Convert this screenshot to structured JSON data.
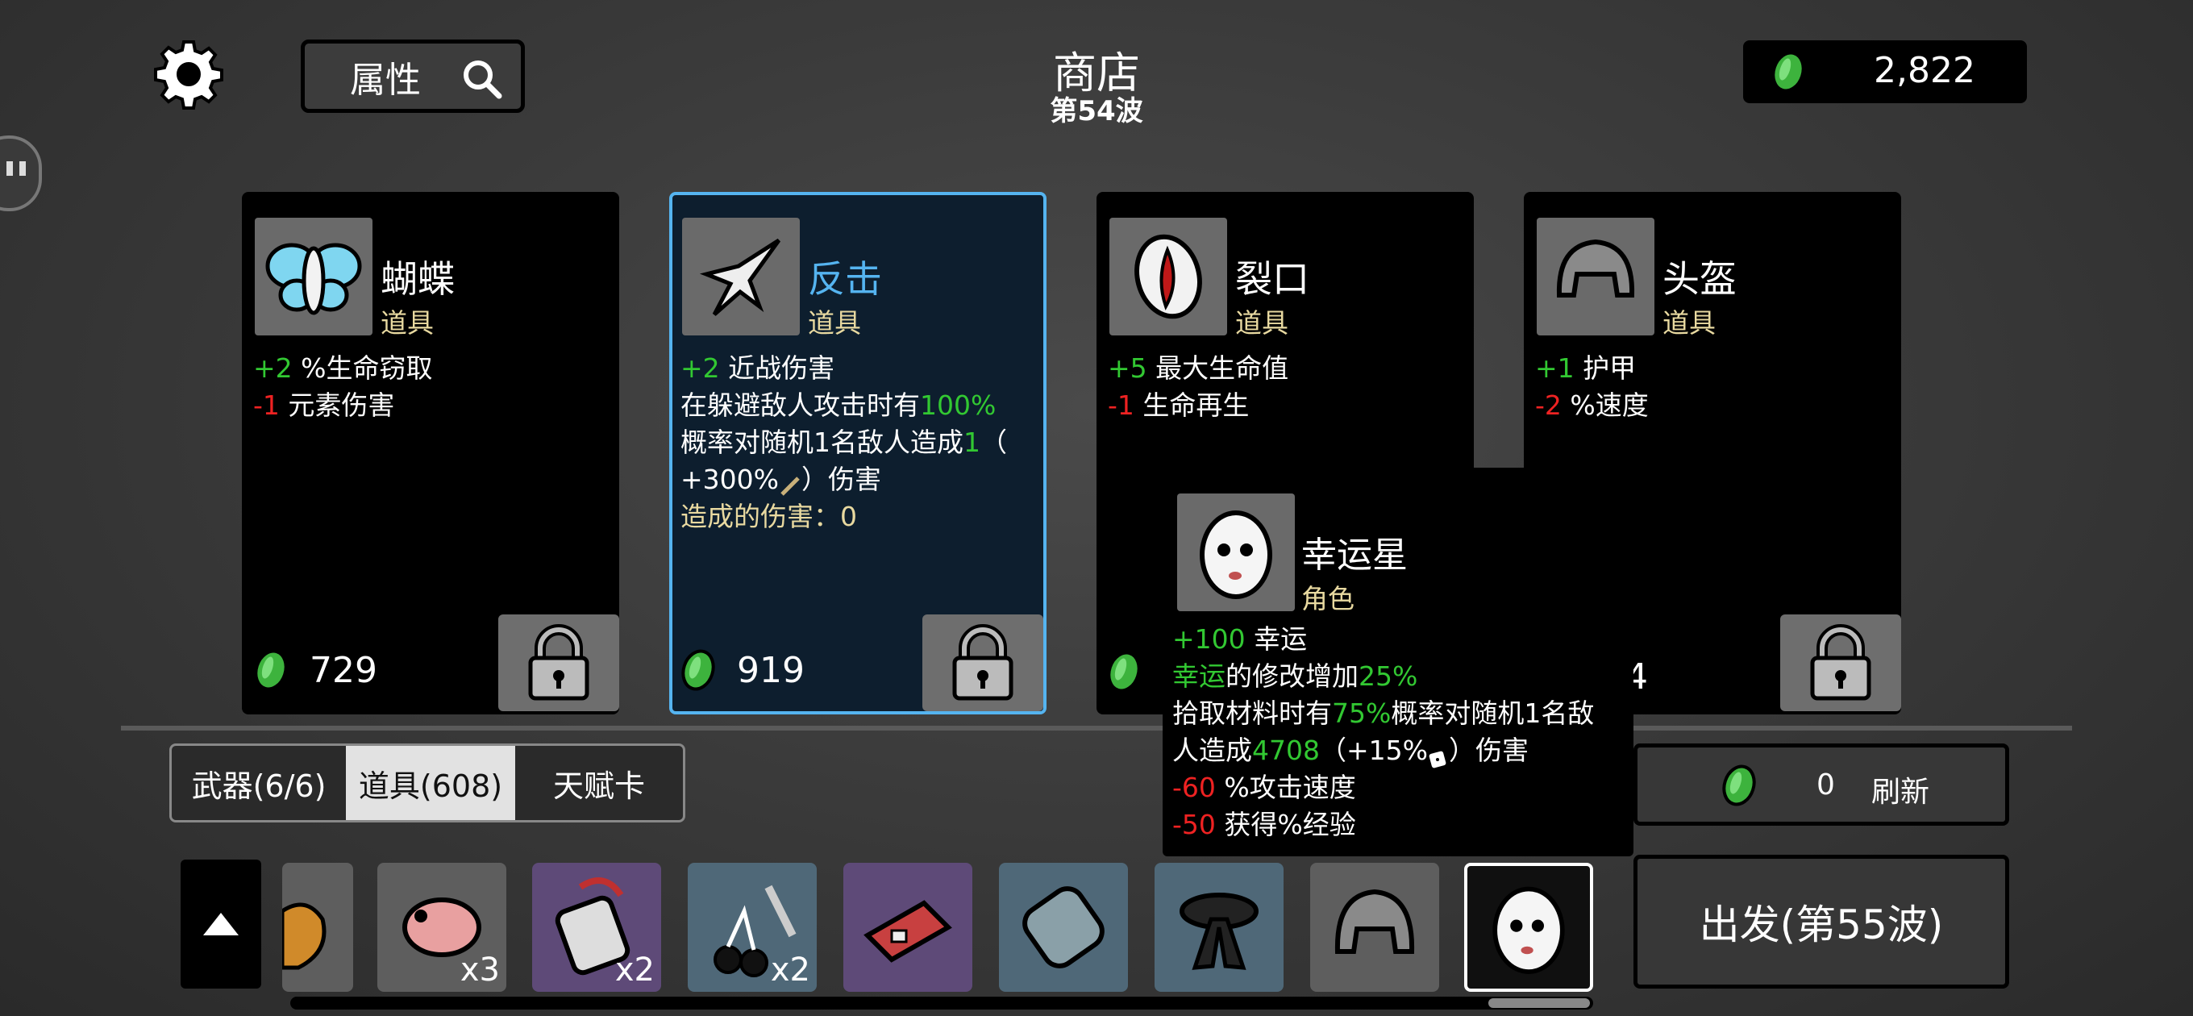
{
  "header": {
    "title": "商店",
    "wave": "第54波",
    "search_label": "属性",
    "gold": "2,822"
  },
  "cards": [
    {
      "name": "蝴蝶",
      "type": "道具",
      "stats": [
        {
          "val": "+2",
          "text": " %生命窃取",
          "color": "g"
        },
        {
          "val": "-1",
          "text": " 元素伤害",
          "color": "r"
        }
      ],
      "price": "729",
      "icon": "butterfly-icon"
    },
    {
      "name": "反击",
      "type": "道具",
      "selected": true,
      "stats": [
        {
          "val": "+2",
          "text": " 近战伤害",
          "color": "g"
        }
      ],
      "line2a": "在躲避敌人攻击时有",
      "line2b": "100%",
      "line3a": "概率对随机1名敌人造成",
      "line3b": "1",
      "line3c": "（",
      "line4": "+300%",
      "line4b": "）伤害",
      "line5": "造成的伤害：0",
      "price": "919",
      "icon": "counter-attack-icon"
    },
    {
      "name": "裂口",
      "type": "道具",
      "stats": [
        {
          "val": "+5",
          "text": " 最大生命值",
          "color": "g"
        },
        {
          "val": "-1",
          "text": " 生命再生",
          "color": "r"
        }
      ],
      "price": "",
      "icon": "rip-icon"
    },
    {
      "name": "头盔",
      "type": "道具",
      "stats": [
        {
          "val": "+1",
          "text": " 护甲",
          "color": "g"
        },
        {
          "val": "-2",
          "text": " %速度",
          "color": "r"
        }
      ],
      "price": "",
      "icon": "helmet-icon"
    }
  ],
  "hidden_price_fragment": "4",
  "tooltip": {
    "name": "幸运星",
    "type": "角色",
    "l1v": "+100",
    "l1t": " 幸运",
    "l2a": "幸运",
    "l2b": "的修改增加",
    "l2c": "25%",
    "l3a": "拾取材料时有",
    "l3b": "75%",
    "l3c": "概率对随机1名敌",
    "l4a": "人造成",
    "l4b": "4708",
    "l4c": "（+15%",
    "l4d": "）伤害",
    "l5v": "-60",
    "l5t": " %攻击速度",
    "l6v": "-50",
    "l6t": " 获得%经验"
  },
  "tabs": [
    "武器(6/6)",
    "道具(608)",
    "天赋卡"
  ],
  "active_tab": 1,
  "inventory": [
    {
      "icon": "partial-item-icon",
      "count": ""
    },
    {
      "icon": "pig-item-icon",
      "count": "x3"
    },
    {
      "icon": "bandage-item-icon",
      "count": "x2"
    },
    {
      "icon": "cherry-knife-icon",
      "count": "x2"
    },
    {
      "icon": "toolbox-icon",
      "count": ""
    },
    {
      "icon": "chain-icon",
      "count": ""
    },
    {
      "icon": "black-belt-icon",
      "count": ""
    },
    {
      "icon": "helmet-icon",
      "count": ""
    },
    {
      "icon": "lucky-egg-icon",
      "count": ""
    }
  ],
  "reroll": {
    "price": "0",
    "label": "刷新"
  },
  "go_label": "出发(第55波)",
  "colors": {
    "positive": "#32c832",
    "negative": "#e22222",
    "type": "#e8d9a0",
    "selected_border": "#55b4f0",
    "coin": "#3db33d"
  }
}
